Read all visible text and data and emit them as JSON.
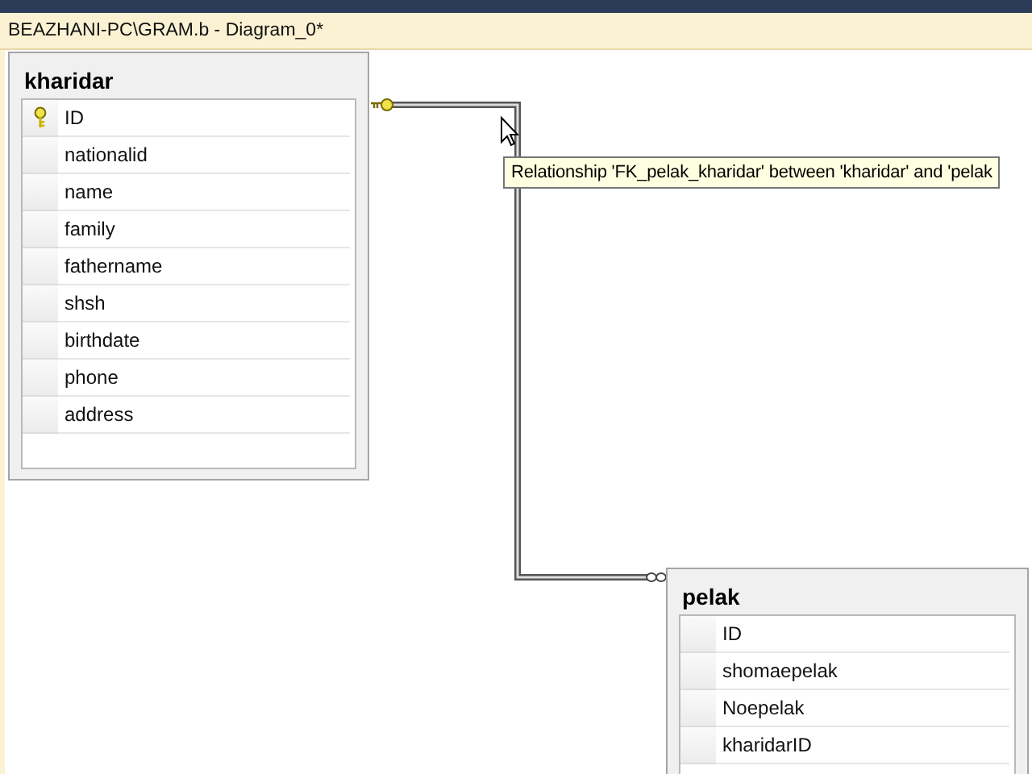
{
  "document_tab": {
    "title": "BEAZHANI-PC\\GRAM.b - Diagram_0*"
  },
  "tables": [
    {
      "name": "kharidar",
      "columns": [
        {
          "name": "ID",
          "primary_key": true
        },
        {
          "name": "nationalid",
          "primary_key": false
        },
        {
          "name": "name",
          "primary_key": false
        },
        {
          "name": "family",
          "primary_key": false
        },
        {
          "name": "fathername",
          "primary_key": false
        },
        {
          "name": "shsh",
          "primary_key": false
        },
        {
          "name": "birthdate",
          "primary_key": false
        },
        {
          "name": "phone",
          "primary_key": false
        },
        {
          "name": "address",
          "primary_key": false
        }
      ]
    },
    {
      "name": "pelak",
      "columns": [
        {
          "name": "ID",
          "primary_key": false
        },
        {
          "name": "shomaepelak",
          "primary_key": false
        },
        {
          "name": "Noepelak",
          "primary_key": false
        },
        {
          "name": "kharidarID",
          "primary_key": false
        }
      ]
    }
  ],
  "tooltip": {
    "text": "Relationship 'FK_pelak_kharidar' between 'kharidar' and 'pelak"
  }
}
